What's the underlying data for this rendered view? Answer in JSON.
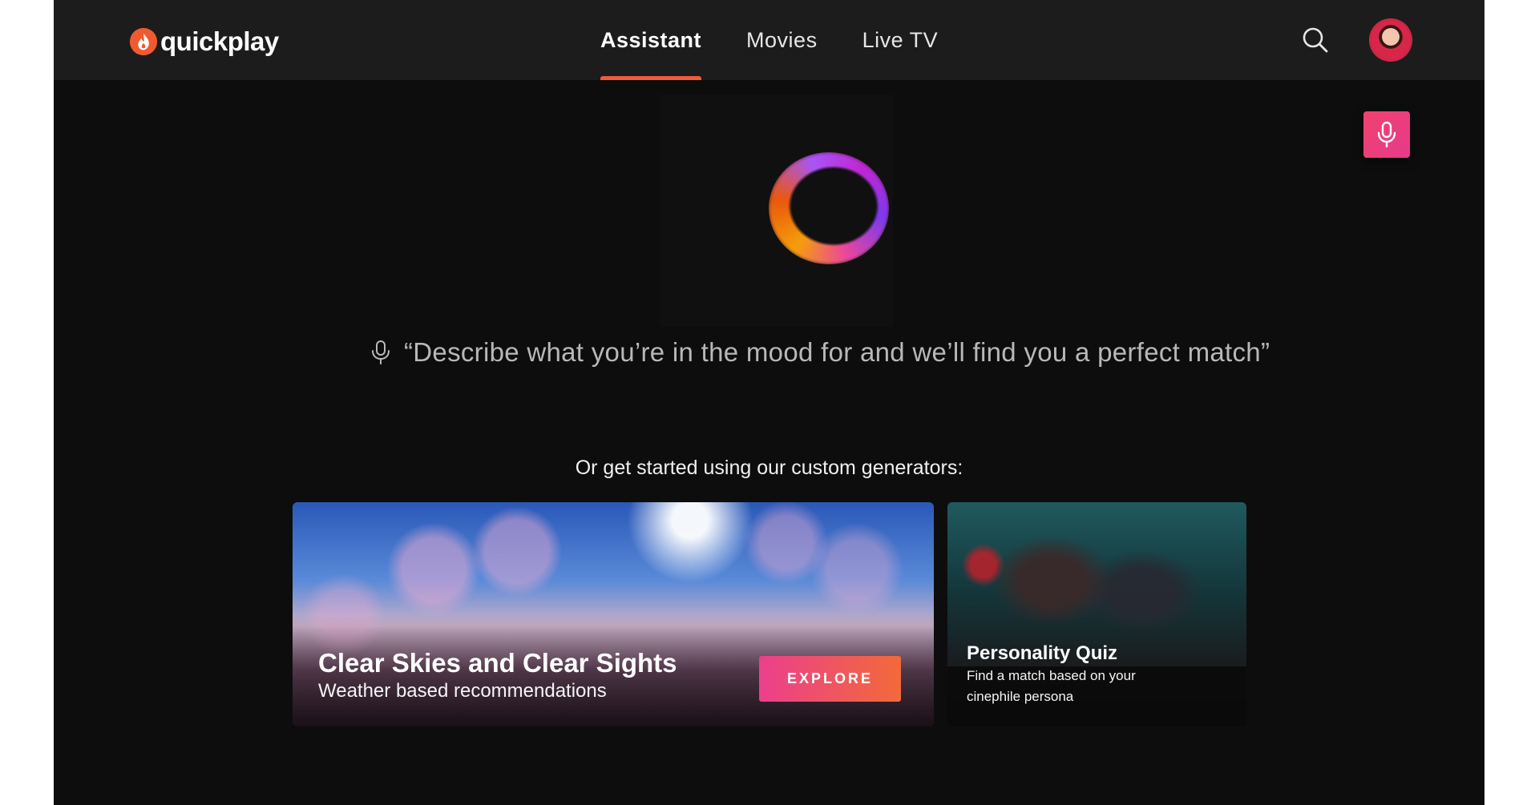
{
  "header": {
    "logo_text": "quickplay",
    "nav": [
      {
        "label": "Assistant",
        "active": true
      },
      {
        "label": "Movies",
        "active": false
      },
      {
        "label": "Live TV",
        "active": false
      }
    ],
    "icons": {
      "search": "search-icon",
      "avatar": "user-avatar",
      "mic": "microphone-icon"
    }
  },
  "assistant": {
    "prompt": "“Describe what you’re in the mood for and we’ll find you a perfect match”"
  },
  "generators": {
    "label": "Or get started using our custom generators:",
    "cards": [
      {
        "title": "Clear Skies and Clear Sights",
        "subtitle": "Weather based recommendations",
        "button": "EXPLORE"
      },
      {
        "title": "Personality Quiz",
        "subtitle": "Find a match based on your cinephile persona"
      }
    ]
  },
  "colors": {
    "accent": "#f05a3a",
    "mic_button": "#e8407a",
    "background": "#0d0d0d",
    "header": "#1c1c1c"
  }
}
